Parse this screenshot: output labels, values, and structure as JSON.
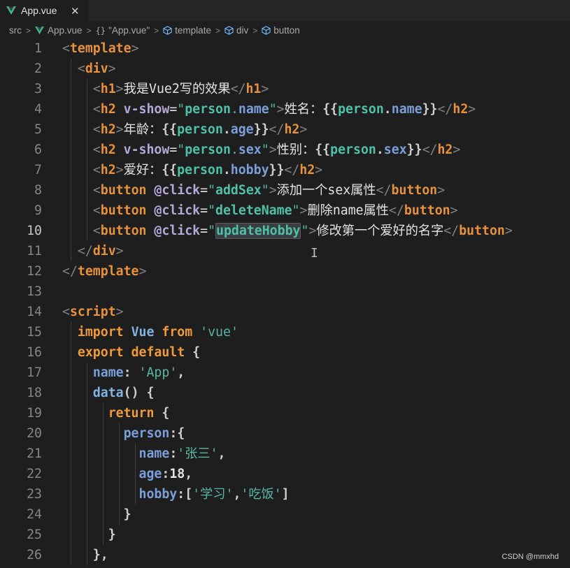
{
  "tab": {
    "title": "App.vue",
    "close_glyph": "✕"
  },
  "breadcrumb": {
    "items": [
      {
        "label": "src",
        "icon": "none"
      },
      {
        "label": "App.vue",
        "icon": "vue-icon"
      },
      {
        "label": "\"App.vue\"",
        "icon": "braces-icon"
      },
      {
        "label": "template",
        "icon": "cube-icon"
      },
      {
        "label": "div",
        "icon": "cube-icon"
      },
      {
        "label": "button",
        "icon": "cube-icon"
      }
    ],
    "separator": ">"
  },
  "editor": {
    "active_line": 10,
    "lines": [
      {
        "n": "1",
        "tokens": [
          [
            "t-bracket",
            "<"
          ],
          [
            "t-tag",
            "template"
          ],
          [
            "t-bracket",
            ">"
          ]
        ]
      },
      {
        "n": "2",
        "tokens": [
          [
            "t-plain",
            "  "
          ],
          [
            "t-bracket",
            "<"
          ],
          [
            "t-tag",
            "div"
          ],
          [
            "t-bracket",
            ">"
          ]
        ]
      },
      {
        "n": "3",
        "tokens": [
          [
            "t-plain",
            "    "
          ],
          [
            "t-bracket",
            "<"
          ],
          [
            "t-tag",
            "h1"
          ],
          [
            "t-bracket",
            ">"
          ],
          [
            "t-text",
            "我是Vue2写的效果"
          ],
          [
            "t-bracket",
            "</"
          ],
          [
            "t-tag",
            "h1"
          ],
          [
            "t-bracket",
            ">"
          ]
        ]
      },
      {
        "n": "4",
        "tokens": [
          [
            "t-plain",
            "    "
          ],
          [
            "t-bracket",
            "<"
          ],
          [
            "t-tag",
            "h2"
          ],
          [
            "t-plain",
            " "
          ],
          [
            "t-attr",
            "v-show"
          ],
          [
            "t-text",
            "="
          ],
          [
            "t-str",
            "\""
          ],
          [
            "t-strval",
            "person"
          ],
          [
            "t-str",
            "."
          ],
          [
            "t-prop",
            "name"
          ],
          [
            "t-str",
            "\""
          ],
          [
            "t-bracket",
            ">"
          ],
          [
            "t-text",
            "姓名："
          ],
          [
            "t-plain",
            "{{"
          ],
          [
            "t-strval",
            "person"
          ],
          [
            "t-plain",
            "."
          ],
          [
            "t-prop",
            "name"
          ],
          [
            "t-plain",
            "}}"
          ],
          [
            "t-bracket",
            "</"
          ],
          [
            "t-tag",
            "h2"
          ],
          [
            "t-bracket",
            ">"
          ]
        ]
      },
      {
        "n": "5",
        "tokens": [
          [
            "t-plain",
            "    "
          ],
          [
            "t-bracket",
            "<"
          ],
          [
            "t-tag",
            "h2"
          ],
          [
            "t-bracket",
            ">"
          ],
          [
            "t-text",
            "年龄："
          ],
          [
            "t-plain",
            "{{"
          ],
          [
            "t-strval",
            "person"
          ],
          [
            "t-plain",
            "."
          ],
          [
            "t-prop",
            "age"
          ],
          [
            "t-plain",
            "}}"
          ],
          [
            "t-bracket",
            "</"
          ],
          [
            "t-tag",
            "h2"
          ],
          [
            "t-bracket",
            ">"
          ]
        ]
      },
      {
        "n": "6",
        "tokens": [
          [
            "t-plain",
            "    "
          ],
          [
            "t-bracket",
            "<"
          ],
          [
            "t-tag",
            "h2"
          ],
          [
            "t-plain",
            " "
          ],
          [
            "t-attr",
            "v-show"
          ],
          [
            "t-text",
            "="
          ],
          [
            "t-str",
            "\""
          ],
          [
            "t-strval",
            "person"
          ],
          [
            "t-str",
            "."
          ],
          [
            "t-prop",
            "sex"
          ],
          [
            "t-str",
            "\""
          ],
          [
            "t-bracket",
            ">"
          ],
          [
            "t-text",
            "性别："
          ],
          [
            "t-plain",
            "{{"
          ],
          [
            "t-strval",
            "person"
          ],
          [
            "t-plain",
            "."
          ],
          [
            "t-prop",
            "sex"
          ],
          [
            "t-plain",
            "}}"
          ],
          [
            "t-bracket",
            "</"
          ],
          [
            "t-tag",
            "h2"
          ],
          [
            "t-bracket",
            ">"
          ]
        ]
      },
      {
        "n": "7",
        "tokens": [
          [
            "t-plain",
            "    "
          ],
          [
            "t-bracket",
            "<"
          ],
          [
            "t-tag",
            "h2"
          ],
          [
            "t-bracket",
            ">"
          ],
          [
            "t-text",
            "爱好："
          ],
          [
            "t-plain",
            "{{"
          ],
          [
            "t-strval",
            "person"
          ],
          [
            "t-plain",
            "."
          ],
          [
            "t-prop",
            "hobby"
          ],
          [
            "t-plain",
            "}}"
          ],
          [
            "t-bracket",
            "</"
          ],
          [
            "t-tag",
            "h2"
          ],
          [
            "t-bracket",
            ">"
          ]
        ]
      },
      {
        "n": "8",
        "tokens": [
          [
            "t-plain",
            "    "
          ],
          [
            "t-bracket",
            "<"
          ],
          [
            "t-tag",
            "button"
          ],
          [
            "t-plain",
            " "
          ],
          [
            "t-attr",
            "@click"
          ],
          [
            "t-text",
            "="
          ],
          [
            "t-str",
            "\""
          ],
          [
            "t-strval",
            "addSex"
          ],
          [
            "t-str",
            "\""
          ],
          [
            "t-bracket",
            ">"
          ],
          [
            "t-text",
            "添加一个sex属性"
          ],
          [
            "t-bracket",
            "</"
          ],
          [
            "t-tag",
            "button"
          ],
          [
            "t-bracket",
            ">"
          ]
        ]
      },
      {
        "n": "9",
        "tokens": [
          [
            "t-plain",
            "    "
          ],
          [
            "t-bracket",
            "<"
          ],
          [
            "t-tag",
            "button"
          ],
          [
            "t-plain",
            " "
          ],
          [
            "t-attr",
            "@click"
          ],
          [
            "t-text",
            "="
          ],
          [
            "t-str",
            "\""
          ],
          [
            "t-strval",
            "deleteName"
          ],
          [
            "t-str",
            "\""
          ],
          [
            "t-bracket",
            ">"
          ],
          [
            "t-text",
            "删除name属性"
          ],
          [
            "t-bracket",
            "</"
          ],
          [
            "t-tag",
            "button"
          ],
          [
            "t-bracket",
            ">"
          ]
        ]
      },
      {
        "n": "10",
        "tokens": [
          [
            "t-plain",
            "    "
          ],
          [
            "t-bracket",
            "<"
          ],
          [
            "t-tag",
            "button"
          ],
          [
            "t-plain",
            " "
          ],
          [
            "t-attr",
            "@click"
          ],
          [
            "t-text",
            "="
          ],
          [
            "t-str",
            "\""
          ],
          [
            "t-strval t-hl",
            "updateHobby"
          ],
          [
            "t-str",
            "\""
          ],
          [
            "t-bracket",
            ">"
          ],
          [
            "t-text",
            "修改第一个爱好的名字"
          ],
          [
            "t-bracket",
            "</"
          ],
          [
            "t-tag",
            "button"
          ],
          [
            "t-bracket",
            ">"
          ]
        ]
      },
      {
        "n": "11",
        "tokens": [
          [
            "t-plain",
            "  "
          ],
          [
            "t-bracket",
            "</"
          ],
          [
            "t-tag",
            "div"
          ],
          [
            "t-bracket",
            ">"
          ]
        ]
      },
      {
        "n": "12",
        "tokens": [
          [
            "t-bracket",
            "</"
          ],
          [
            "t-tag",
            "template"
          ],
          [
            "t-bracket",
            ">"
          ]
        ]
      },
      {
        "n": "13",
        "tokens": []
      },
      {
        "n": "14",
        "tokens": [
          [
            "t-bracket",
            "<"
          ],
          [
            "t-tag",
            "script"
          ],
          [
            "t-bracket",
            ">"
          ]
        ]
      },
      {
        "n": "15",
        "tokens": [
          [
            "t-plain",
            "  "
          ],
          [
            "t-kw",
            "import"
          ],
          [
            "t-plain",
            " "
          ],
          [
            "t-fn",
            "Vue"
          ],
          [
            "t-plain",
            " "
          ],
          [
            "t-kw",
            "from"
          ],
          [
            "t-plain",
            " "
          ],
          [
            "t-str",
            "'vue'"
          ]
        ]
      },
      {
        "n": "16",
        "tokens": [
          [
            "t-plain",
            "  "
          ],
          [
            "t-kw",
            "export"
          ],
          [
            "t-plain",
            " "
          ],
          [
            "t-kw",
            "default"
          ],
          [
            "t-plain",
            " {"
          ]
        ]
      },
      {
        "n": "17",
        "tokens": [
          [
            "t-plain",
            "    "
          ],
          [
            "t-prop",
            "name"
          ],
          [
            "t-plain",
            ": "
          ],
          [
            "t-str",
            "'App'"
          ],
          [
            "t-plain",
            ","
          ]
        ]
      },
      {
        "n": "18",
        "tokens": [
          [
            "t-plain",
            "    "
          ],
          [
            "t-fn",
            "data"
          ],
          [
            "t-plain",
            "() {"
          ]
        ]
      },
      {
        "n": "19",
        "tokens": [
          [
            "t-plain",
            "      "
          ],
          [
            "t-kw",
            "return"
          ],
          [
            "t-plain",
            " {"
          ]
        ]
      },
      {
        "n": "20",
        "tokens": [
          [
            "t-plain",
            "        "
          ],
          [
            "t-prop",
            "person"
          ],
          [
            "t-plain",
            ":{"
          ]
        ]
      },
      {
        "n": "21",
        "tokens": [
          [
            "t-plain",
            "          "
          ],
          [
            "t-prop",
            "name"
          ],
          [
            "t-plain",
            ":"
          ],
          [
            "t-str",
            "'张三'"
          ],
          [
            "t-plain",
            ","
          ]
        ]
      },
      {
        "n": "22",
        "tokens": [
          [
            "t-plain",
            "          "
          ],
          [
            "t-prop",
            "age"
          ],
          [
            "t-plain",
            ":"
          ],
          [
            "t-num",
            "18"
          ],
          [
            "t-plain",
            ","
          ]
        ]
      },
      {
        "n": "23",
        "tokens": [
          [
            "t-plain",
            "          "
          ],
          [
            "t-prop",
            "hobby"
          ],
          [
            "t-plain",
            ":["
          ],
          [
            "t-str",
            "'学习'"
          ],
          [
            "t-plain",
            ","
          ],
          [
            "t-str",
            "'吃饭'"
          ],
          [
            "t-plain",
            "]"
          ]
        ]
      },
      {
        "n": "24",
        "tokens": [
          [
            "t-plain",
            "        }"
          ]
        ]
      },
      {
        "n": "25",
        "tokens": [
          [
            "t-plain",
            "      }"
          ]
        ]
      },
      {
        "n": "26",
        "tokens": [
          [
            "t-plain",
            "    },"
          ]
        ]
      }
    ]
  },
  "watermark": "CSDN @mmxhd",
  "colors": {
    "background": "#1e1e1e",
    "tag": "#e8913c",
    "string": "#57b6a3",
    "attr": "#b3a8d8",
    "property": "#7a9fd9"
  }
}
